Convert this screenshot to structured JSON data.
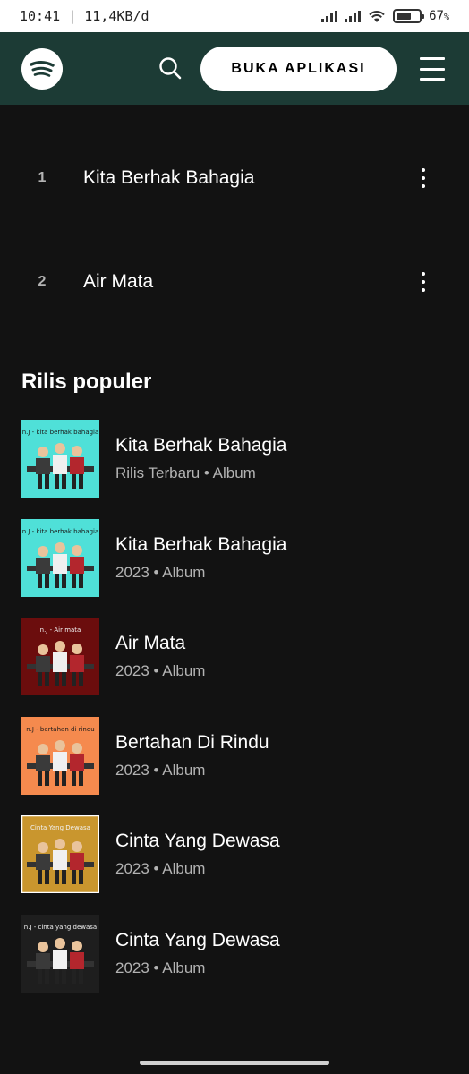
{
  "status_bar": {
    "time_speed": "10:41 | 11,4KB/d",
    "battery_percent": "67",
    "battery_unit": "%",
    "battery_level": 0.67
  },
  "header": {
    "logo": "spotify-logo",
    "search_icon": "search-icon",
    "open_app_label": "BUKA APLIKASI",
    "menu_icon": "hamburger-icon",
    "bg_color": "#1c3b35"
  },
  "tracks": [
    {
      "number": "1",
      "title": "Kita Berhak Bahagia"
    },
    {
      "number": "2",
      "title": "Air Mata"
    }
  ],
  "popular_releases": {
    "title": "Rilis populer",
    "items": [
      {
        "title": "Kita Berhak Bahagia",
        "meta": "Rilis Terbaru • Album",
        "cover_color": "#4fe0d8",
        "cover_text": "n.J - kita berhak bahagia"
      },
      {
        "title": "Kita Berhak Bahagia",
        "meta": "2023 • Album",
        "cover_color": "#4fe0d8",
        "cover_text": "n.J - kita berhak bahagia"
      },
      {
        "title": "Air Mata",
        "meta": "2023 • Album",
        "cover_color": "#6b0d0d",
        "cover_text": "n.J - Air mata"
      },
      {
        "title": "Bertahan Di Rindu",
        "meta": "2023 • Album",
        "cover_color": "#f58a4e",
        "cover_text": "n.J - bertahan di rindu"
      },
      {
        "title": "Cinta Yang Dewasa",
        "meta": "2023 • Album",
        "cover_color": "#c9962e",
        "cover_text": "Cinta Yang Dewasa"
      },
      {
        "title": "Cinta Yang Dewasa",
        "meta": "2023 • Album",
        "cover_color": "#1e1e1e",
        "cover_text": "n.J - cinta yang dewasa"
      }
    ]
  }
}
